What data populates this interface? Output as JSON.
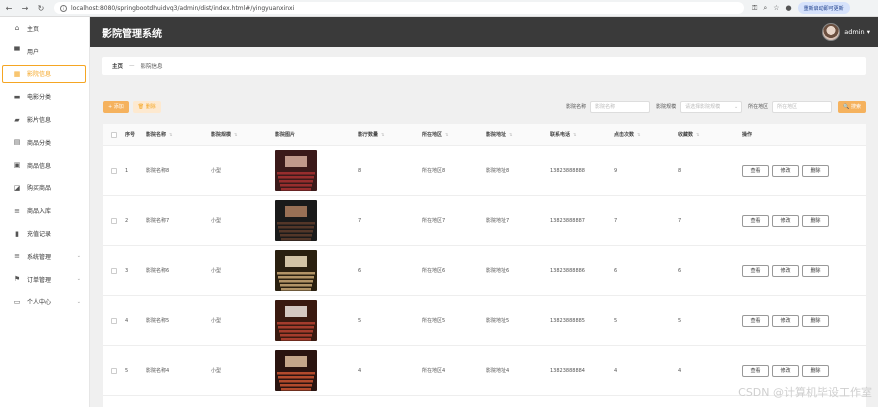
{
  "browser": {
    "url": "localhost:8080/springbootdhuidvq3/admin/dist/index.html#/yingyuanxinxi",
    "update_label": "重新启动即可更新"
  },
  "header": {
    "title": "影院管理系统",
    "user": "admin ▾"
  },
  "sidebar": {
    "items": [
      {
        "label": "主页",
        "icon": "home-icon"
      },
      {
        "label": "用户",
        "icon": "monitor-icon"
      },
      {
        "label": "影院信息",
        "icon": "grid-icon",
        "active": true
      },
      {
        "label": "电影分类",
        "icon": "briefcase-icon"
      },
      {
        "label": "影片信息",
        "icon": "comment-icon"
      },
      {
        "label": "商品分类",
        "icon": "clipboard-icon"
      },
      {
        "label": "商品信息",
        "icon": "id-card-icon"
      },
      {
        "label": "购买商品",
        "icon": "chart-icon"
      },
      {
        "label": "商品入库",
        "icon": "list-icon"
      },
      {
        "label": "充值记录",
        "icon": "bar-chart-icon"
      },
      {
        "label": "系统管理",
        "icon": "list-icon",
        "has_children": true
      },
      {
        "label": "订单管理",
        "icon": "flag-icon",
        "has_children": true
      },
      {
        "label": "个人中心",
        "icon": "calendar-icon",
        "has_children": true
      }
    ]
  },
  "breadcrumb": {
    "home": "主页",
    "sep": "—",
    "current": "影院信息"
  },
  "toolbar": {
    "add_label": "+ 添加",
    "delete_label": "🗑 删除",
    "filter_name_label": "影院名称",
    "filter_name_placeholder": "影院名称",
    "filter_size_label": "影院规模",
    "filter_size_placeholder": "请选择影院规模",
    "filter_area_label": "所在地区",
    "filter_area_placeholder": "所在地区",
    "search_label": "🔍 搜索"
  },
  "table": {
    "headers": {
      "index": "序号",
      "name": "影院名称",
      "size": "影院规模",
      "image": "影院图片",
      "count": "影厅数量",
      "area": "所在地区",
      "address": "影院地址",
      "phone": "联系电话",
      "clicks": "点击次数",
      "favorites": "收藏数",
      "ops": "操作"
    },
    "op_labels": {
      "view": "查看",
      "edit": "修改",
      "delete": "删除"
    },
    "rows": [
      {
        "index": "1",
        "name": "影院名称8",
        "size": "小型",
        "count": "8",
        "area": "所在地区8",
        "address": "影院地址8",
        "phone": "13823888888",
        "clicks": "9",
        "favorites": "8"
      },
      {
        "index": "2",
        "name": "影院名称7",
        "size": "小型",
        "count": "7",
        "area": "所在地区7",
        "address": "影院地址7",
        "phone": "13823888887",
        "clicks": "7",
        "favorites": "7"
      },
      {
        "index": "3",
        "name": "影院名称6",
        "size": "小型",
        "count": "6",
        "area": "所在地区6",
        "address": "影院地址6",
        "phone": "13823888886",
        "clicks": "6",
        "favorites": "6"
      },
      {
        "index": "4",
        "name": "影院名称5",
        "size": "小型",
        "count": "5",
        "area": "所在地区5",
        "address": "影院地址5",
        "phone": "13823888885",
        "clicks": "5",
        "favorites": "5"
      },
      {
        "index": "5",
        "name": "影院名称4",
        "size": "小型",
        "count": "4",
        "area": "所在地区4",
        "address": "影院地址4",
        "phone": "13823888884",
        "clicks": "4",
        "favorites": "4"
      }
    ]
  },
  "watermark": "CSDN @计算机毕设工作室",
  "colors": {
    "accent": "#f5a623",
    "header_bg": "#3a3a3a"
  }
}
